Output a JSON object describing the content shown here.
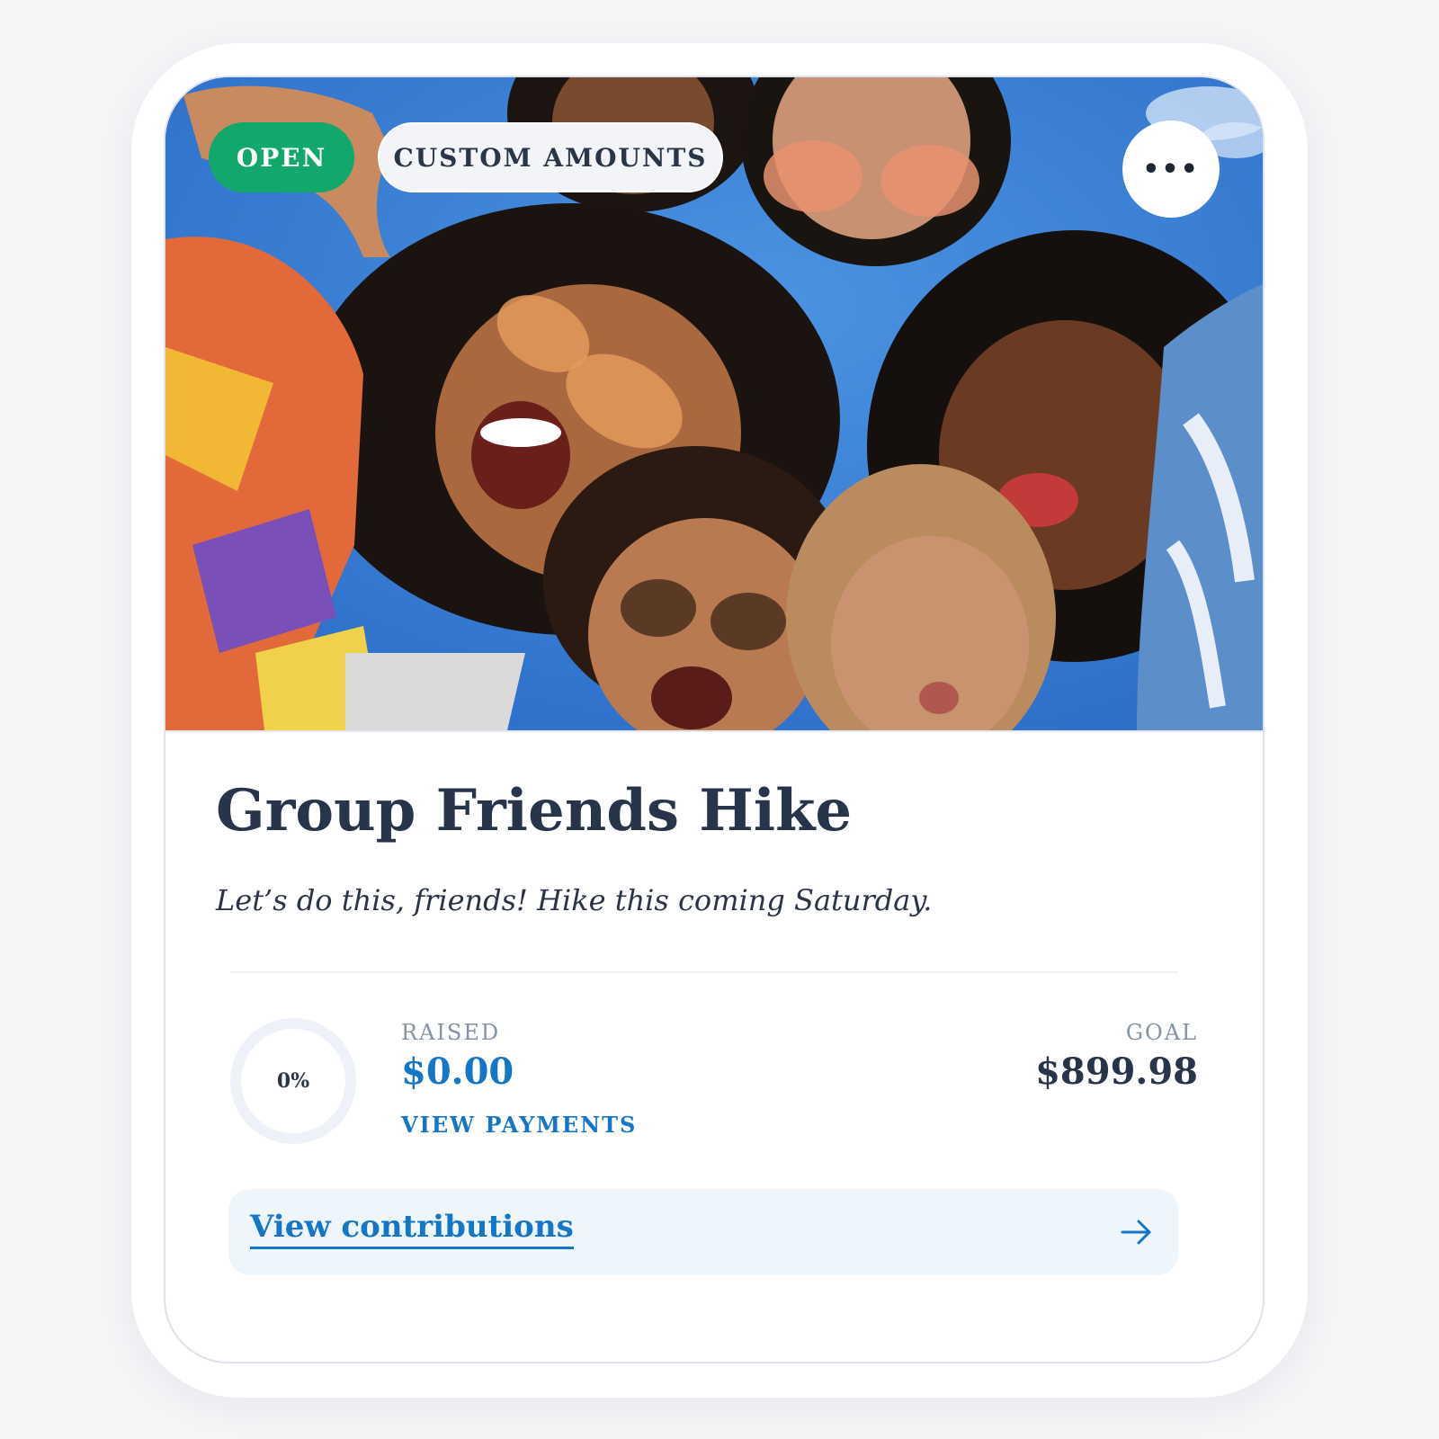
{
  "card": {
    "badges": {
      "status": "OPEN",
      "mode": "CUSTOM AMOUNTS"
    },
    "more_button_glyph": "•••",
    "image_alt": "Group of friends looking down at the camera",
    "title": "Group Friends Hike",
    "description": "Let’s do this, friends! Hike this coming Saturday.",
    "progress": {
      "percent_label": "0%",
      "percent_value": 0
    },
    "raised": {
      "label": "RAISED",
      "amount": "$0.00",
      "link": "VIEW PAYMENTS"
    },
    "goal": {
      "label": "GOAL",
      "amount": "$899.98"
    },
    "contributions": {
      "label": "View contributions",
      "icon": "arrow-right-icon"
    }
  },
  "colors": {
    "open_badge": "#12a86b",
    "accent": "#1576c8",
    "title": "#273449",
    "muted_label": "#8592a6",
    "contrib_bg": "#eef6fc"
  }
}
